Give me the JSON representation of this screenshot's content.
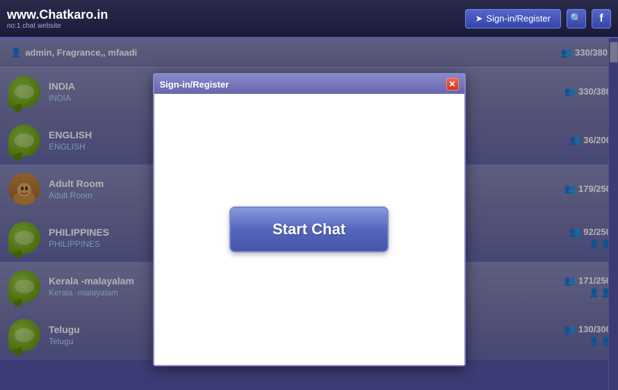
{
  "header": {
    "logo_main": "www.Chatkaro.in",
    "logo_main_dot": ".",
    "logo_sub": "no:1 chat website",
    "signin_label": "Sign-in/Register",
    "search_icon": "🔍",
    "fb_icon": "f"
  },
  "room_list_header": {
    "admin_icon": "👤",
    "admins": "admin, Fragrance,, mfaadi",
    "total_count": "330/380"
  },
  "rooms": [
    {
      "name": "INDIA",
      "desc": "INDIA",
      "count": "330/380",
      "icon_type": "bubble",
      "show_person_icons": false
    },
    {
      "name": "ENGLISH",
      "desc": "ENGLISH",
      "count": "36/200",
      "icon_type": "bubble",
      "show_person_icons": false
    },
    {
      "name": "Adult Room",
      "desc": "Adult Room",
      "count": "179/250",
      "icon_type": "avatar",
      "show_person_icons": false
    },
    {
      "name": "PHILIPPINES",
      "desc": "PHILIPPINES",
      "count": "92/250",
      "icon_type": "bubble",
      "show_person_icons": true
    },
    {
      "name": "Kerala -malayalam",
      "desc": "Kerala -malayalam",
      "count": "171/250",
      "icon_type": "bubble",
      "show_person_icons": true
    },
    {
      "name": "Telugu",
      "desc": "Telugu",
      "count": "130/300",
      "icon_type": "bubble",
      "show_person_icons": true
    }
  ],
  "modal": {
    "title": "Sign-in/Register",
    "close_label": "✕",
    "start_chat_label": "Start Chat"
  }
}
